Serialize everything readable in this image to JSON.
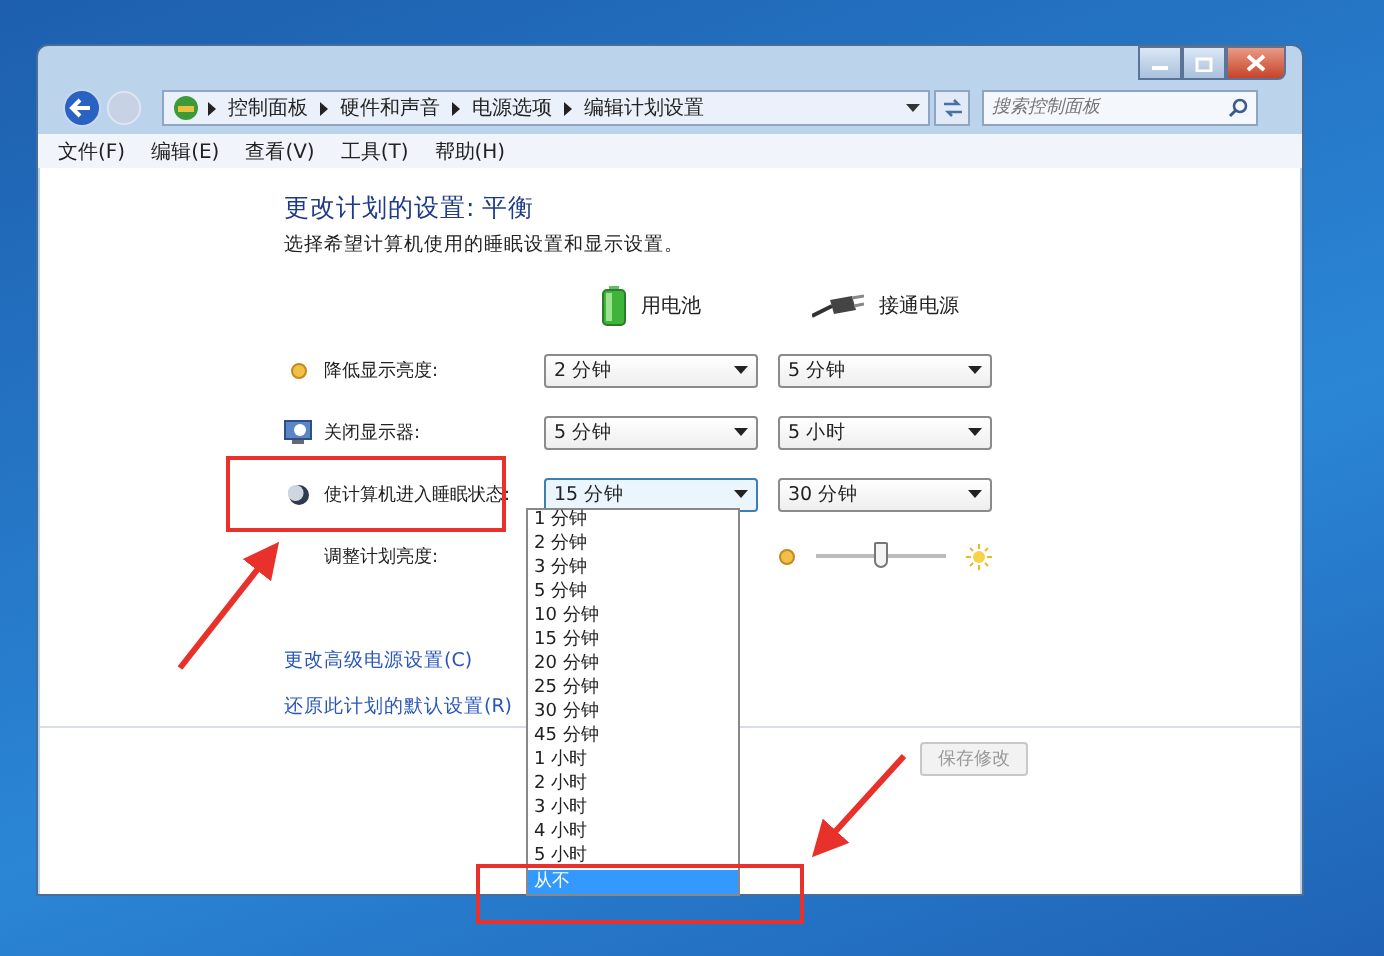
{
  "address_bar": {
    "breadcrumbs": [
      "控制面板",
      "硬件和声音",
      "电源选项",
      "编辑计划设置"
    ],
    "search": {
      "placeholder": "搜索控制面板"
    }
  },
  "menu": [
    "文件(F)",
    "编辑(E)",
    "查看(V)",
    "工具(T)",
    "帮助(H)"
  ],
  "heading": "更改计划的设置: 平衡",
  "subtitle": "选择希望计算机使用的睡眠设置和显示设置。",
  "columns": [
    {
      "label": "用电池",
      "kind": "battery"
    },
    {
      "label": "接通电源",
      "kind": "plug"
    }
  ],
  "settings": [
    {
      "kind": "select",
      "label": "降低显示亮度:",
      "values": [
        "2 分钟",
        "5 分钟"
      ],
      "open": false
    },
    {
      "kind": "select",
      "label": "关闭显示器:",
      "values": [
        "5 分钟",
        "5 小时"
      ],
      "open": false
    },
    {
      "kind": "select",
      "label": "使计算机进入睡眠状态:",
      "values": [
        "15 分钟",
        "30 分钟"
      ],
      "open": true
    },
    {
      "kind": "slider",
      "label": "调整计划亮度:",
      "level": 0.5
    }
  ],
  "dropdown_options": [
    {
      "label": "1 分钟",
      "selected": false
    },
    {
      "label": "2 分钟",
      "selected": false
    },
    {
      "label": "3 分钟",
      "selected": false
    },
    {
      "label": "5 分钟",
      "selected": false
    },
    {
      "label": "10 分钟",
      "selected": false
    },
    {
      "label": "15 分钟",
      "selected": false
    },
    {
      "label": "20 分钟",
      "selected": false
    },
    {
      "label": "25 分钟",
      "selected": false
    },
    {
      "label": "30 分钟",
      "selected": false
    },
    {
      "label": "45 分钟",
      "selected": false
    },
    {
      "label": "1 小时",
      "selected": false
    },
    {
      "label": "2 小时",
      "selected": false
    },
    {
      "label": "3 小时",
      "selected": false
    },
    {
      "label": "4 小时",
      "selected": false
    },
    {
      "label": "5 小时",
      "selected": false
    },
    {
      "label": "从不",
      "selected": true
    }
  ],
  "links": [
    "更改高级电源设置(C)",
    "还原此计划的默认设置(R)"
  ],
  "save_button": {
    "label": "保存修改",
    "disabled": true
  }
}
